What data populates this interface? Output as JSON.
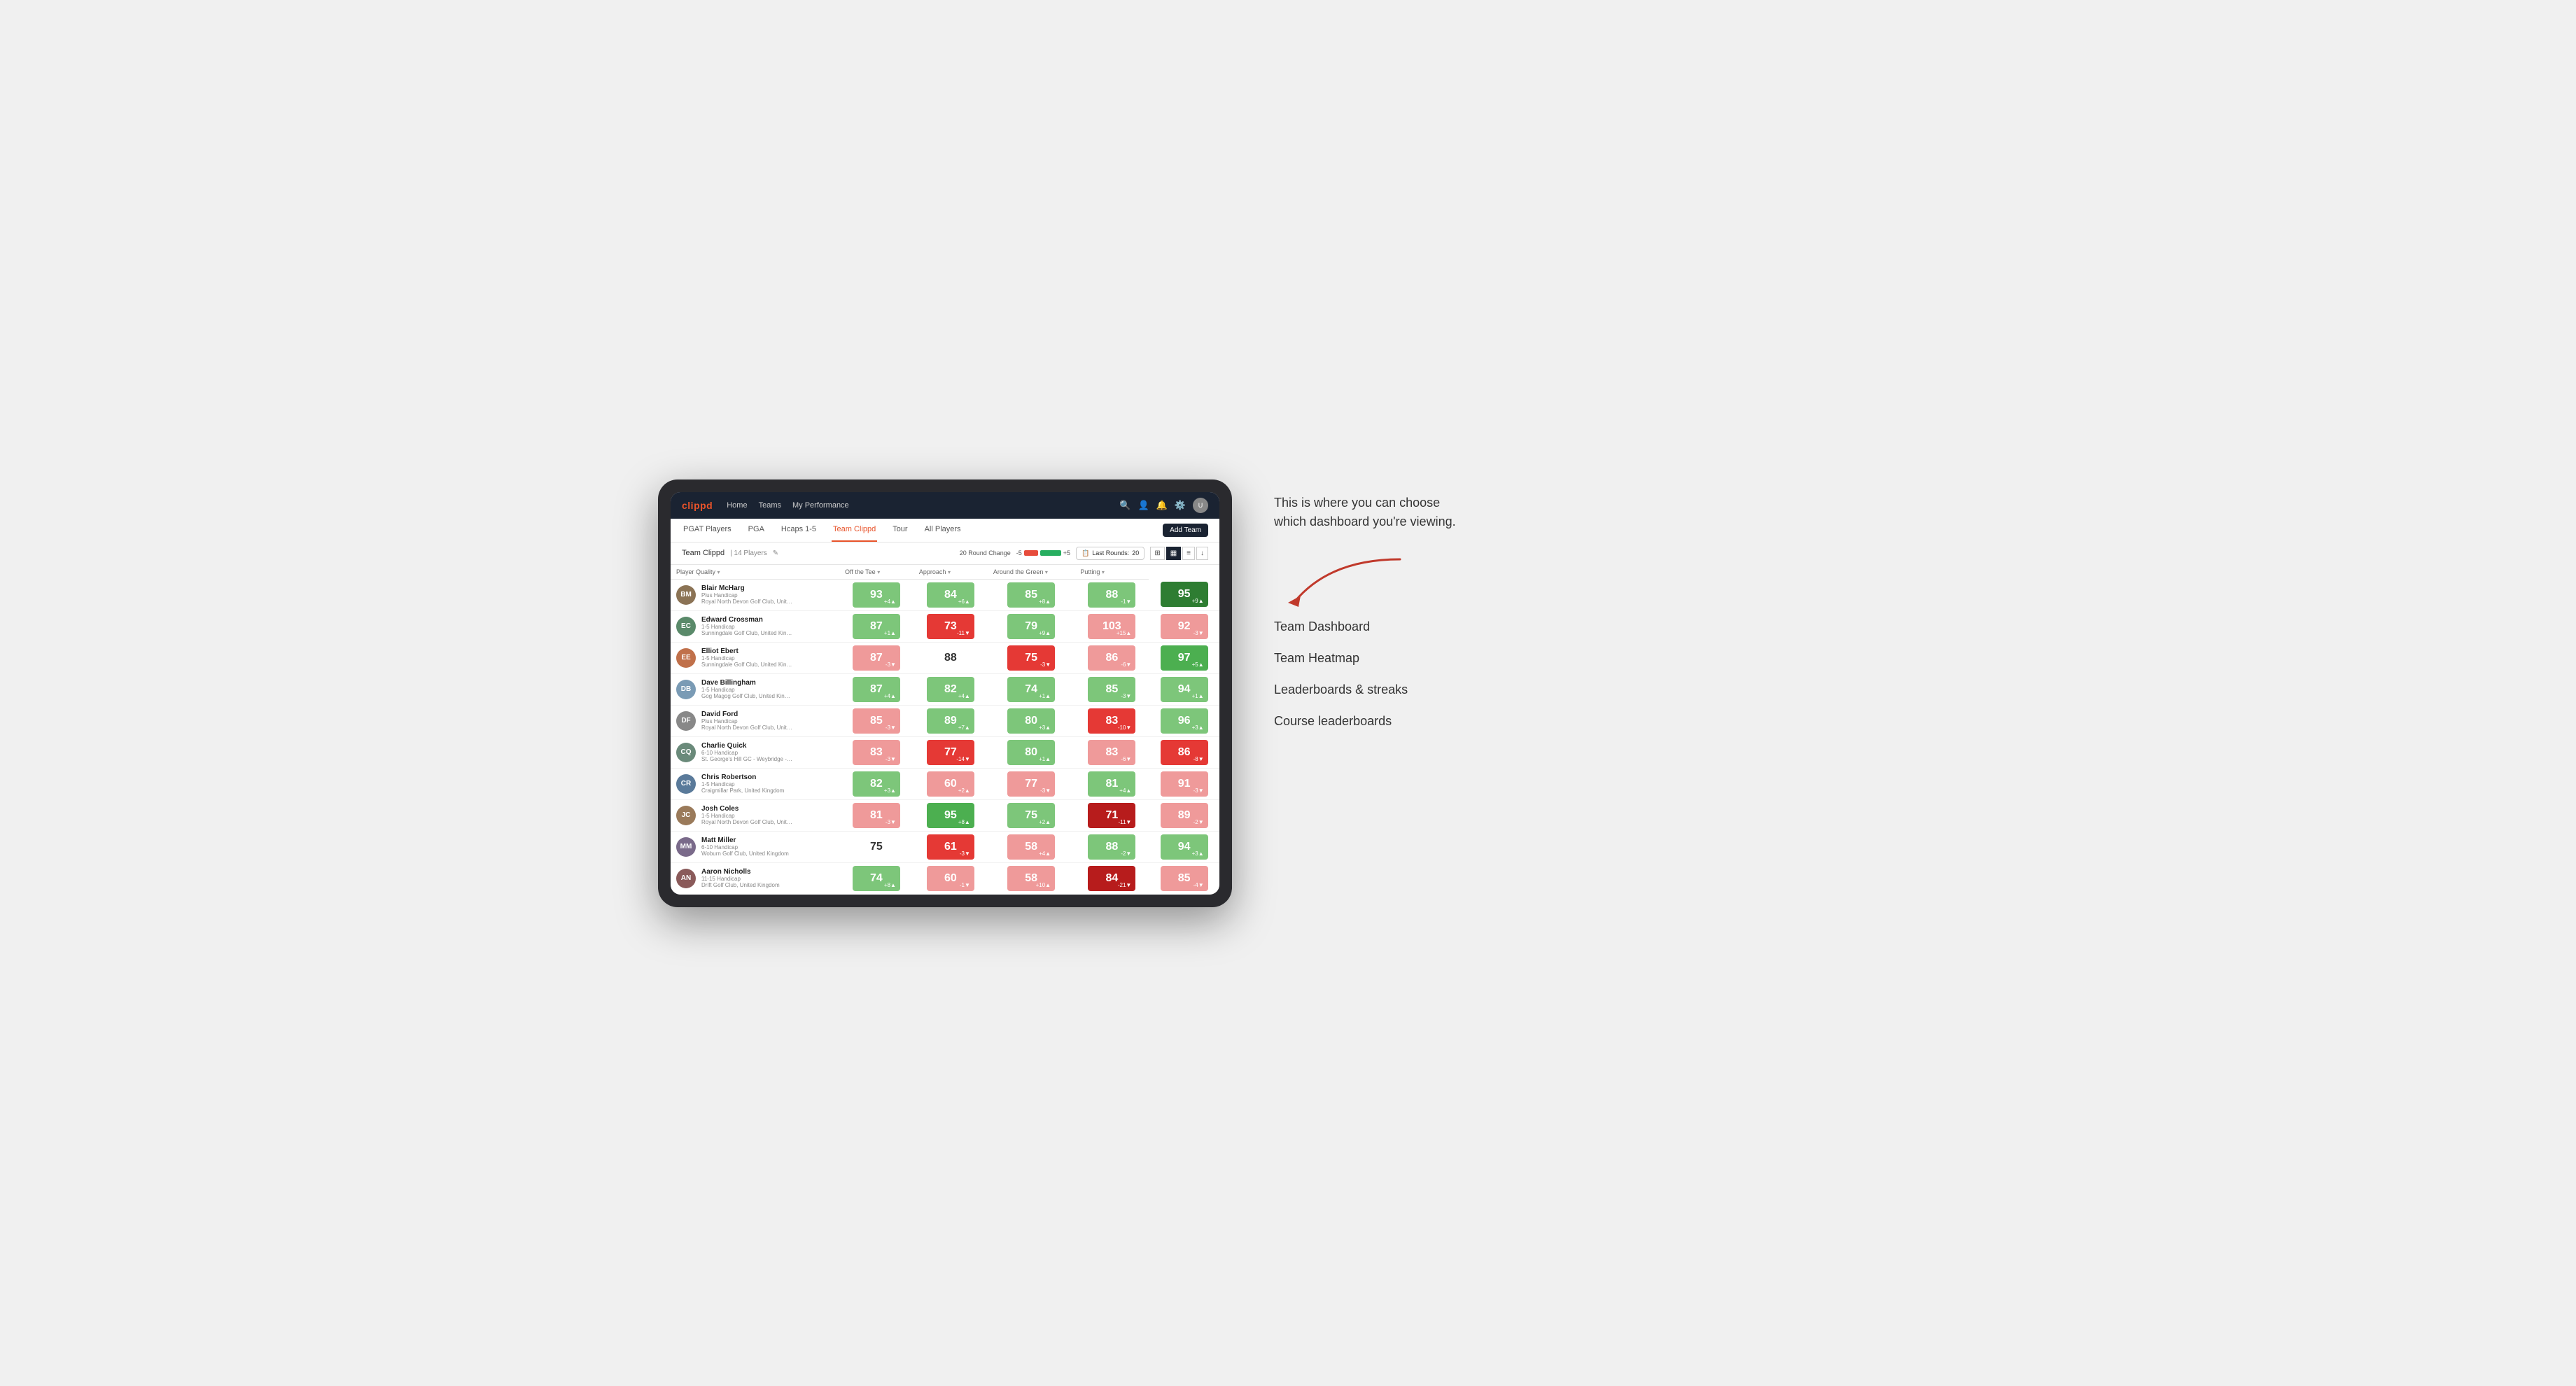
{
  "annotation": {
    "callout": "This is where you can choose which dashboard you're viewing.",
    "items": [
      "Team Dashboard",
      "Team Heatmap",
      "Leaderboards & streaks",
      "Course leaderboards"
    ]
  },
  "navbar": {
    "brand": "clippd",
    "nav_items": [
      "Home",
      "Teams",
      "My Performance"
    ],
    "icons": [
      "search",
      "person",
      "bell",
      "settings",
      "avatar"
    ]
  },
  "subnav": {
    "items": [
      "PGAT Players",
      "PGA",
      "Hcaps 1-5",
      "Team Clippd",
      "Tour",
      "All Players"
    ],
    "active": "Team Clippd",
    "add_button": "Add Team"
  },
  "team_header": {
    "title": "Team Clippd",
    "separator": "|",
    "count": "14 Players",
    "round_change_label": "20 Round Change",
    "neg_label": "-5",
    "pos_label": "+5",
    "last_rounds_label": "Last Rounds:",
    "last_rounds_value": "20"
  },
  "table": {
    "columns": [
      "Player Quality ▾",
      "Off the Tee ▾",
      "Approach ▾",
      "Around the Green ▾",
      "Putting ▾"
    ],
    "rows": [
      {
        "name": "Blair McHarg",
        "handicap": "Plus Handicap",
        "club": "Royal North Devon Golf Club, United Kingdom",
        "avatar_color": "#8B7355",
        "scores": [
          {
            "value": 93,
            "change": "+4",
            "trend": "up",
            "color": "green-light"
          },
          {
            "value": 84,
            "change": "+6",
            "trend": "up",
            "color": "green-light"
          },
          {
            "value": 85,
            "change": "+8",
            "trend": "up",
            "color": "green-light"
          },
          {
            "value": 88,
            "change": "-1",
            "trend": "down",
            "color": "green-light"
          },
          {
            "value": 95,
            "change": "+9",
            "trend": "up",
            "color": "green-dark"
          }
        ]
      },
      {
        "name": "Edward Crossman",
        "handicap": "1-5 Handicap",
        "club": "Sunningdale Golf Club, United Kingdom",
        "avatar_color": "#5a8a6a",
        "scores": [
          {
            "value": 87,
            "change": "+1",
            "trend": "up",
            "color": "green-light"
          },
          {
            "value": 73,
            "change": "-11",
            "trend": "down",
            "color": "red-mid"
          },
          {
            "value": 79,
            "change": "+9",
            "trend": "up",
            "color": "green-light"
          },
          {
            "value": 103,
            "change": "+15",
            "trend": "up",
            "color": "red-light"
          },
          {
            "value": 92,
            "change": "-3",
            "trend": "down",
            "color": "red-light"
          }
        ]
      },
      {
        "name": "Elliot Ebert",
        "handicap": "1-5 Handicap",
        "club": "Sunningdale Golf Club, United Kingdom",
        "avatar_color": "#c0704a",
        "scores": [
          {
            "value": 87,
            "change": "-3",
            "trend": "down",
            "color": "red-light"
          },
          {
            "value": 88,
            "change": "",
            "trend": "",
            "color": "white"
          },
          {
            "value": 75,
            "change": "-3",
            "trend": "down",
            "color": "red-mid"
          },
          {
            "value": 86,
            "change": "-6",
            "trend": "down",
            "color": "red-light"
          },
          {
            "value": 97,
            "change": "+5",
            "trend": "up",
            "color": "green-mid"
          }
        ]
      },
      {
        "name": "Dave Billingham",
        "handicap": "1-5 Handicap",
        "club": "Gog Magog Golf Club, United Kingdom",
        "avatar_color": "#7a9bb5",
        "scores": [
          {
            "value": 87,
            "change": "+4",
            "trend": "up",
            "color": "green-light"
          },
          {
            "value": 82,
            "change": "+4",
            "trend": "up",
            "color": "green-light"
          },
          {
            "value": 74,
            "change": "+1",
            "trend": "up",
            "color": "green-light"
          },
          {
            "value": 85,
            "change": "-3",
            "trend": "down",
            "color": "green-light"
          },
          {
            "value": 94,
            "change": "+1",
            "trend": "up",
            "color": "green-light"
          }
        ]
      },
      {
        "name": "David Ford",
        "handicap": "Plus Handicap",
        "club": "Royal North Devon Golf Club, United Kingdom",
        "avatar_color": "#888",
        "scores": [
          {
            "value": 85,
            "change": "-3",
            "trend": "down",
            "color": "red-light"
          },
          {
            "value": 89,
            "change": "+7",
            "trend": "up",
            "color": "green-light"
          },
          {
            "value": 80,
            "change": "+3",
            "trend": "up",
            "color": "green-light"
          },
          {
            "value": 83,
            "change": "-10",
            "trend": "down",
            "color": "red-mid"
          },
          {
            "value": 96,
            "change": "+3",
            "trend": "up",
            "color": "green-light"
          }
        ]
      },
      {
        "name": "Charlie Quick",
        "handicap": "6-10 Handicap",
        "club": "St. George's Hill GC - Weybridge - Surrey, Uni...",
        "avatar_color": "#6a8a7a",
        "scores": [
          {
            "value": 83,
            "change": "-3",
            "trend": "down",
            "color": "red-light"
          },
          {
            "value": 77,
            "change": "-14",
            "trend": "down",
            "color": "red-mid"
          },
          {
            "value": 80,
            "change": "+1",
            "trend": "up",
            "color": "green-light"
          },
          {
            "value": 83,
            "change": "-6",
            "trend": "down",
            "color": "red-light"
          },
          {
            "value": 86,
            "change": "-8",
            "trend": "down",
            "color": "red-mid"
          }
        ]
      },
      {
        "name": "Chris Robertson",
        "handicap": "1-5 Handicap",
        "club": "Craigmillar Park, United Kingdom",
        "avatar_color": "#5a7a9a",
        "scores": [
          {
            "value": 82,
            "change": "+3",
            "trend": "up",
            "color": "green-light"
          },
          {
            "value": 60,
            "change": "+2",
            "trend": "up",
            "color": "red-light"
          },
          {
            "value": 77,
            "change": "-3",
            "trend": "down",
            "color": "red-light"
          },
          {
            "value": 81,
            "change": "+4",
            "trend": "up",
            "color": "green-light"
          },
          {
            "value": 91,
            "change": "-3",
            "trend": "down",
            "color": "red-light"
          }
        ]
      },
      {
        "name": "Josh Coles",
        "handicap": "1-5 Handicap",
        "club": "Royal North Devon Golf Club, United Kingdom",
        "avatar_color": "#9a7a5a",
        "scores": [
          {
            "value": 81,
            "change": "-3",
            "trend": "down",
            "color": "red-light"
          },
          {
            "value": 95,
            "change": "+8",
            "trend": "up",
            "color": "green-mid"
          },
          {
            "value": 75,
            "change": "+2",
            "trend": "up",
            "color": "green-light"
          },
          {
            "value": 71,
            "change": "-11",
            "trend": "down",
            "color": "red-dark"
          },
          {
            "value": 89,
            "change": "-2",
            "trend": "down",
            "color": "red-light"
          }
        ]
      },
      {
        "name": "Matt Miller",
        "handicap": "6-10 Handicap",
        "club": "Woburn Golf Club, United Kingdom",
        "avatar_color": "#7a6a8a",
        "scores": [
          {
            "value": 75,
            "change": "",
            "trend": "",
            "color": "white"
          },
          {
            "value": 61,
            "change": "-3",
            "trend": "down",
            "color": "red-mid"
          },
          {
            "value": 58,
            "change": "+4",
            "trend": "up",
            "color": "red-light"
          },
          {
            "value": 88,
            "change": "-2",
            "trend": "down",
            "color": "green-light"
          },
          {
            "value": 94,
            "change": "+3",
            "trend": "up",
            "color": "green-light"
          }
        ]
      },
      {
        "name": "Aaron Nicholls",
        "handicap": "11-15 Handicap",
        "club": "Drift Golf Club, United Kingdom",
        "avatar_color": "#8a5a5a",
        "scores": [
          {
            "value": 74,
            "change": "+8",
            "trend": "up",
            "color": "green-light"
          },
          {
            "value": 60,
            "change": "-1",
            "trend": "down",
            "color": "red-light"
          },
          {
            "value": 58,
            "change": "+10",
            "trend": "up",
            "color": "red-light"
          },
          {
            "value": 84,
            "change": "-21",
            "trend": "down",
            "color": "red-dark"
          },
          {
            "value": 85,
            "change": "-4",
            "trend": "down",
            "color": "red-light"
          }
        ]
      }
    ]
  },
  "labels": {
    "edit_icon": "✎",
    "check_icon": "⊕",
    "table_icon": "⊞",
    "heat_icon": "⊟",
    "download_icon": "↓",
    "search_unicode": "🔍",
    "person_unicode": "👤",
    "bell_unicode": "🔔",
    "gear_unicode": "⚙"
  }
}
